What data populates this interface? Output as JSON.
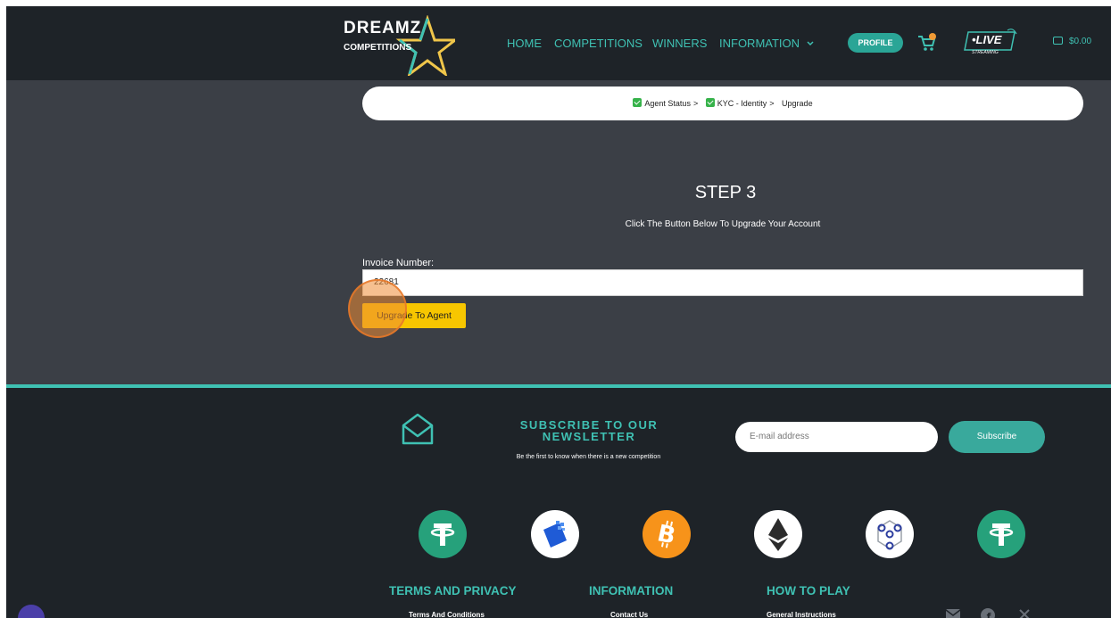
{
  "header": {
    "logo": {
      "line1": "DREAMZ",
      "line2": "COMPETITIONS"
    },
    "nav": [
      {
        "label": "HOME"
      },
      {
        "label": "COMPETITIONS"
      },
      {
        "label": "WINNERS"
      },
      {
        "label": "INFORMATION"
      }
    ],
    "profile_label": "PROFILE",
    "live_label": "•LIVE",
    "live_sub": "STREAMING",
    "wallet_amount": "$0.00"
  },
  "breadcrumb": {
    "items": [
      "Agent Status",
      "KYC - Identity"
    ],
    "separator": ">",
    "current": "Upgrade"
  },
  "step": {
    "title": "STEP 3",
    "subtitle": "Click The Button Below To Upgrade Your Account"
  },
  "invoice": {
    "label": "Invoice Number:",
    "value": "22681"
  },
  "upgrade_button": "Upgrade To Agent",
  "footer": {
    "newsletter_title": "SUBSCRIBE TO OUR NEWSLETTER",
    "newsletter_sub": "Be the first to know when there is a new competition",
    "email_placeholder": "E-mail address",
    "subscribe_label": "Subscribe",
    "coins": [
      "tether-icon",
      "wallet-icon",
      "bitcoin-icon",
      "ethereum-icon",
      "network-icon",
      "tether-icon"
    ],
    "columns": [
      {
        "heading": "TERMS AND PRIVACY",
        "link": "Terms And Conditions"
      },
      {
        "heading": "INFORMATION",
        "link": "Contact Us"
      },
      {
        "heading": "HOW TO PLAY",
        "link": "General Instructions"
      }
    ]
  },
  "colors": {
    "accent": "#3fc1b3",
    "header_bg": "#1e2328",
    "body_bg": "#3b3f46",
    "button_yellow": "#f7c600"
  }
}
